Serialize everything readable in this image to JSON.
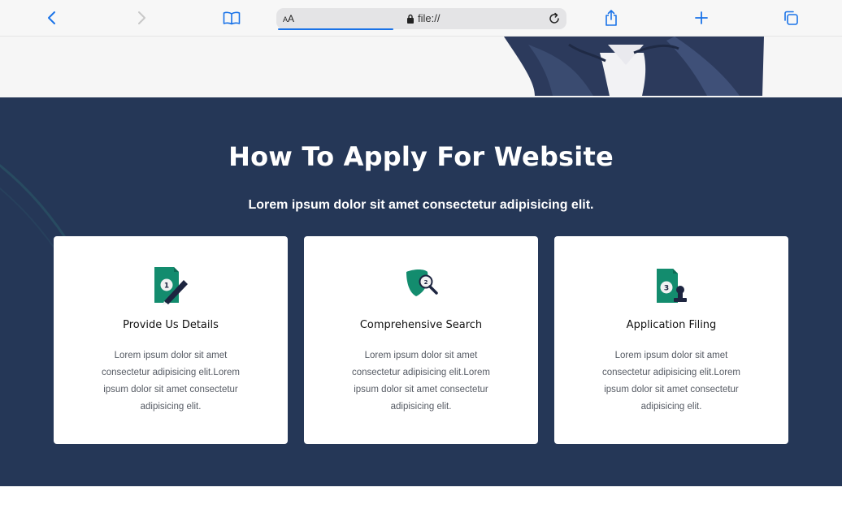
{
  "browser": {
    "aa_label": "AA",
    "url": "file://",
    "colors": {
      "accent": "#1a73e8",
      "toolbar_bg": "#f7f7f7"
    },
    "icons": [
      "back-icon",
      "forward-icon",
      "bookmarks-icon",
      "lock-icon",
      "reload-icon",
      "share-icon",
      "new-tab-icon",
      "tabs-icon"
    ]
  },
  "section": {
    "title": "How To Apply For Website",
    "subtitle": "Lorem ipsum dolor sit amet consectetur adipisicing elit.",
    "colors": {
      "background": "#253757",
      "icon_green": "#138c6e",
      "icon_dark": "#1d2540"
    },
    "cards": [
      {
        "icon": "document-pen-icon",
        "step_number": "1",
        "title": "Provide Us Details",
        "text": "Lorem ipsum dolor sit amet consectetur adipisicing elit.Lorem ipsum dolor sit amet consectetur adipisicing elit."
      },
      {
        "icon": "search-magnifier-icon",
        "step_number": "2",
        "title": "Comprehensive Search",
        "text": "Lorem ipsum dolor sit amet consectetur adipisicing elit.Lorem ipsum dolor sit amet consectetur adipisicing elit."
      },
      {
        "icon": "document-stamp-icon",
        "step_number": "3",
        "title": "Application Filing",
        "text": "Lorem ipsum dolor sit amet consectetur adipisicing elit.Lorem ipsum dolor sit amet consectetur adipisicing elit."
      }
    ]
  }
}
